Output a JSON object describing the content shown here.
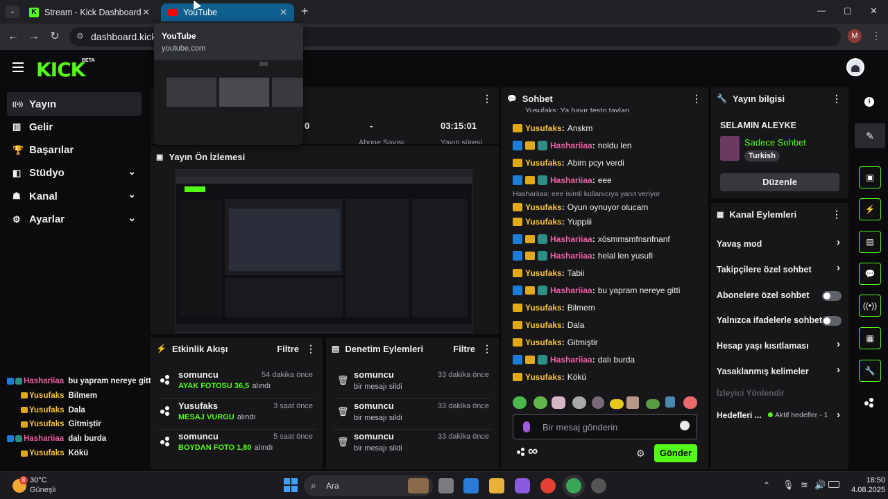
{
  "browser": {
    "tabs": [
      {
        "title": "Stream - Kick Dashboard",
        "active": false
      },
      {
        "title": "YouTube",
        "active": true
      }
    ],
    "url": "dashboard.kick.co",
    "hover_card": {
      "title": "YouTube",
      "domain": "youtube.com"
    },
    "window_controls": [
      "—",
      "▢",
      "✕"
    ],
    "profile_initial": "M"
  },
  "app": {
    "logo": "KICK",
    "logo_tag": "BETA",
    "sidebar": [
      {
        "label": "Yayın",
        "icon": "broadcast-icon",
        "active": true,
        "chevron": false
      },
      {
        "label": "Gelir",
        "icon": "revenue-icon",
        "active": false,
        "chevron": false
      },
      {
        "label": "Başarılar",
        "icon": "trophy-icon",
        "active": false,
        "chevron": false
      },
      {
        "label": "Stüdyo",
        "icon": "studio-icon",
        "active": false,
        "chevron": true
      },
      {
        "label": "Kanal",
        "icon": "channel-icon",
        "active": false,
        "chevron": true
      },
      {
        "label": "Ayarlar",
        "icon": "gear-icon",
        "active": false,
        "chevron": true
      }
    ],
    "overlay_chat": [
      {
        "user": "Hashariiaa",
        "msg": "bu yapram nereye gitti",
        "type": "h"
      },
      {
        "user": "Yusufaks",
        "msg": "Bilmem",
        "type": "y"
      },
      {
        "user": "Yusufaks",
        "msg": "Dala",
        "type": "y"
      },
      {
        "user": "Yusufaks",
        "msg": "Gitmiştir",
        "type": "y"
      },
      {
        "user": "Hashariiaa",
        "msg": "dalı burda",
        "type": "h"
      },
      {
        "user": "Yusufaks",
        "msg": "Kökü",
        "type": "y"
      }
    ],
    "stats": {
      "values": [
        "0",
        "-",
        "03:15:01"
      ],
      "labels_partial": [
        "Takipçi",
        "Abone Sayısı",
        "Yayın süresi"
      ]
    },
    "preview": {
      "title": "Yayın Ön İzlemesi"
    },
    "activity": {
      "title": "Etkinlik Akışı",
      "filter": "Filtre",
      "items": [
        {
          "user": "somuncu",
          "detail": "AYAK FOTOSU 36,5",
          "suffix": "alındı",
          "time": "54 dakika önce"
        },
        {
          "user": "Yusufaks",
          "detail": "MESAJ VURGU",
          "suffix": "alındı",
          "time": "3 saat önce"
        },
        {
          "user": "somuncu",
          "detail": "BOYDAN FOTO 1,80",
          "suffix": "alındı",
          "time": "5 saat önce"
        }
      ]
    },
    "moderation": {
      "title": "Denetim Eylemleri",
      "filter": "Filtre",
      "items": [
        {
          "user": "somuncu",
          "detail": "bir mesajı sildi",
          "time": "33 dakika önce"
        },
        {
          "user": "somuncu",
          "detail": "bir mesajı sildi",
          "time": "33 dakika önce"
        },
        {
          "user": "somuncu",
          "detail": "bir mesajı sildi",
          "time": "33 dakika önce"
        }
      ]
    },
    "chat": {
      "title": "Sohbet",
      "top_partial": "Yusufaks: Ya hayır testo taylan",
      "messages": [
        {
          "user": "Yusufaks",
          "msg": "Anskm",
          "type": "y"
        },
        {
          "user": "Hashariiaa",
          "msg": "noldu len",
          "type": "h"
        },
        {
          "user": "Yusufaks",
          "msg": "Abim pcyı verdi",
          "type": "y"
        },
        {
          "user": "Hashariiaa",
          "msg": "eee",
          "type": "h"
        },
        {
          "user": "Yusufaks",
          "msg": "Oyun oynuyor olucam",
          "type": "y",
          "reply": "Hashariiaa: eee isimli kullanıcıya yanıt veriyor"
        },
        {
          "user": "Yusufaks",
          "msg": "Yuppiii",
          "type": "y"
        },
        {
          "user": "Hashariiaa",
          "msg": "xösmmsmfnsnfnanf",
          "type": "h"
        },
        {
          "user": "Hashariiaa",
          "msg": "helal len yusufi",
          "type": "h"
        },
        {
          "user": "Yusufaks",
          "msg": "Tabii",
          "type": "y"
        },
        {
          "user": "Hashariiaa",
          "msg": "bu yapram nereye gitti",
          "type": "h"
        },
        {
          "user": "Yusufaks",
          "msg": "Bilmem",
          "type": "y"
        },
        {
          "user": "Yusufaks",
          "msg": "Dala",
          "type": "y"
        },
        {
          "user": "Yusufaks",
          "msg": "Gitmiştir",
          "type": "y"
        },
        {
          "user": "Hashariiaa",
          "msg": "dalı burda",
          "type": "h"
        },
        {
          "user": "Yusufaks",
          "msg": "Kökü",
          "type": "y"
        }
      ],
      "placeholder": "Bir mesaj gönderin",
      "send": "Gönder",
      "infinity": "∞"
    },
    "stream_info": {
      "title": "Yayın bilgisi",
      "stream_title": "SELAMIN ALEYKE",
      "category": "Sadece Sohbet",
      "language": "Turkish",
      "edit": "Düzenle"
    },
    "channel_actions": {
      "title": "Kanal Eylemleri",
      "items": [
        {
          "label": "Yavaş mod",
          "control": "arrow"
        },
        {
          "label": "Takipçilere özel sohbet",
          "control": "arrow"
        },
        {
          "label": "Abonelere özel sohbet",
          "control": "toggle"
        },
        {
          "label": "Yalnızca ifadelerle sohbet",
          "control": "toggle"
        },
        {
          "label": "Hesap yaşı kısıtlaması",
          "control": "arrow"
        },
        {
          "label": "Yasaklanmış kelimeler",
          "control": "arrow"
        }
      ],
      "disabled_item": "İzleyici Yönlendir",
      "goals_label": "Hedefleri ...",
      "goals_status": "Aktif hedefler - 1"
    }
  },
  "taskbar": {
    "weather_temp": "30°C",
    "weather_desc": "Güneşli",
    "weather_badge": "8",
    "search": "Ara",
    "time": "18:50",
    "date": "4.08.2025"
  }
}
